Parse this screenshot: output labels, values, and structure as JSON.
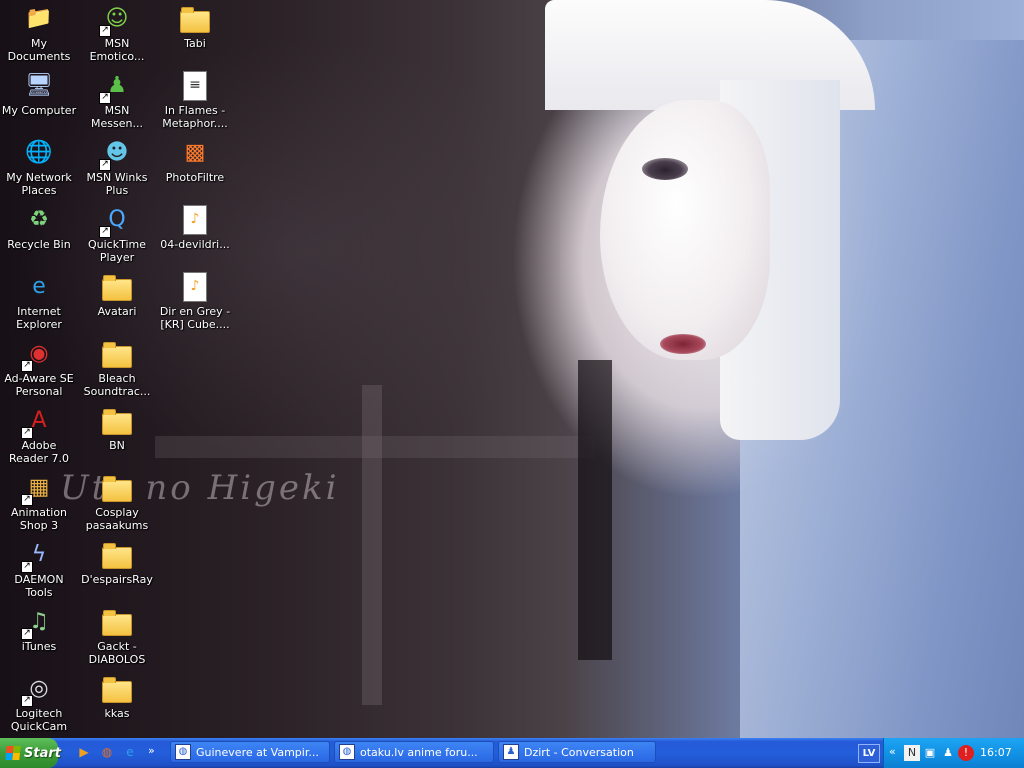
{
  "desktop": {
    "icons": [
      {
        "label": "My\nDocuments",
        "icon": "my-documents-icon",
        "shortcut": false
      },
      {
        "label": "My Computer",
        "icon": "my-computer-icon",
        "shortcut": false
      },
      {
        "label": "My Network\nPlaces",
        "icon": "network-places-icon",
        "shortcut": false
      },
      {
        "label": "Recycle Bin",
        "icon": "recycle-bin-icon",
        "shortcut": false
      },
      {
        "label": "Internet\nExplorer",
        "icon": "internet-explorer-icon",
        "shortcut": false
      },
      {
        "label": "Ad-Aware SE\nPersonal",
        "icon": "ad-aware-icon",
        "shortcut": true
      },
      {
        "label": "Adobe\nReader 7.0",
        "icon": "adobe-reader-icon",
        "shortcut": true
      },
      {
        "label": "Animation\nShop 3",
        "icon": "animation-shop-icon",
        "shortcut": true
      },
      {
        "label": "DAEMON\nTools",
        "icon": "daemon-tools-icon",
        "shortcut": true
      },
      {
        "label": "iTunes",
        "icon": "itunes-icon",
        "shortcut": true
      },
      {
        "label": "Logitech\nQuickCam",
        "icon": "webcam-icon",
        "shortcut": true
      },
      {
        "label": "MSN\nEmotico...",
        "icon": "msn-emoticons-icon",
        "shortcut": true
      },
      {
        "label": "MSN\nMessen...",
        "icon": "msn-messenger-icon",
        "shortcut": true
      },
      {
        "label": "MSN Winks\nPlus",
        "icon": "msn-winks-icon",
        "shortcut": true
      },
      {
        "label": "QuickTime\nPlayer",
        "icon": "quicktime-icon",
        "shortcut": true
      },
      {
        "label": "Avatari",
        "icon": "folder-icon",
        "shortcut": false
      },
      {
        "label": "Bleach\nSoundtrac...",
        "icon": "folder-icon",
        "shortcut": false
      },
      {
        "label": "BN",
        "icon": "folder-icon",
        "shortcut": false
      },
      {
        "label": "Cosplay\npasaakums",
        "icon": "folder-icon",
        "shortcut": false
      },
      {
        "label": "D'espairsRay",
        "icon": "folder-icon",
        "shortcut": false
      },
      {
        "label": "Gackt -\nDIABOLOS",
        "icon": "folder-icon",
        "shortcut": false
      },
      {
        "label": "kkas",
        "icon": "folder-icon",
        "shortcut": false
      },
      {
        "label": "Tabi",
        "icon": "folder-icon",
        "shortcut": false
      },
      {
        "label": "In Flames -\nMetaphor....",
        "icon": "text-document-icon",
        "shortcut": false
      },
      {
        "label": "PhotoFiltre",
        "icon": "photofiltre-icon",
        "shortcut": false
      },
      {
        "label": "04-devildri...",
        "icon": "media-file-icon",
        "shortcut": false
      },
      {
        "label": "Dir en Grey -\n[KR] Cube....",
        "icon": "media-file-icon",
        "shortcut": false
      }
    ]
  },
  "wallpaper": {
    "caption": "Uta no Higeki"
  },
  "taskbar": {
    "start_label": "Start",
    "quick_launch": [
      {
        "icon": "media-player-icon",
        "color": "#f0a020"
      },
      {
        "icon": "firefox-icon",
        "color": "#e8701a"
      },
      {
        "icon": "internet-explorer-icon",
        "color": "#2d9ee8"
      }
    ],
    "quick_launch_more": "»",
    "tasks": [
      {
        "label": "Guinevere at Vampir...",
        "icon": "firefox-icon"
      },
      {
        "label": "otaku.lv anime foru...",
        "icon": "firefox-icon"
      },
      {
        "label": "Dzirt - Conversation",
        "icon": "msn-messenger-icon"
      }
    ],
    "language": "LV",
    "tray_chevron": "«",
    "clock": "16:07"
  }
}
